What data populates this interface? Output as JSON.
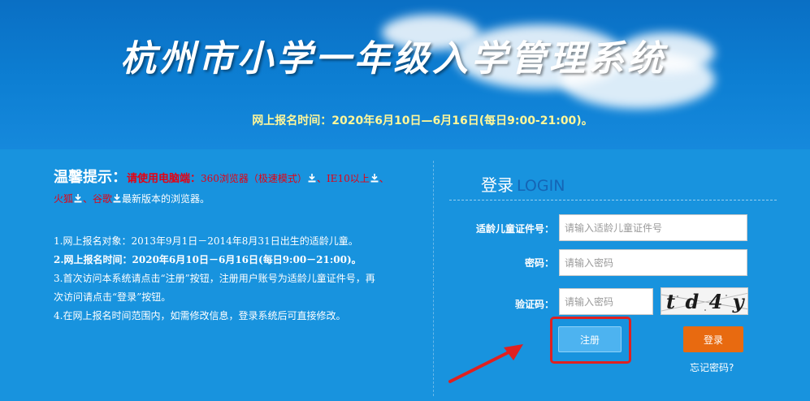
{
  "header": {
    "title": "杭州市小学一年级入学管理系统",
    "reg_time": "网上报名时间：2020年6月10日—6月16日(每日9:00-21:00)。"
  },
  "tips": {
    "heading": "温馨提示：",
    "red_text": "请使用电脑端：",
    "browser_360": "360浏览器（极速模式）",
    "browser_ie": "IE10以上",
    "browser_firefox": "火狐",
    "browser_chrome": "谷歌",
    "suffix": "最新版本的浏览器。",
    "item1": "1.网上报名对象：2013年9月1日－2014年8月31日出生的适龄儿童。",
    "item2": "2.网上报名时间：2020年6月10日－6月16日(每日9:00－21:00)。",
    "item3a": "3.首次访问本系统请点击“注册”按钮，注册用户账号为适龄儿童证件号，再",
    "item3b": "次访问请点击“登录”按钮。",
    "item4": "4.在网上报名时间范围内，如需修改信息，登录系统后可直接修改。",
    "sep1": "、",
    "sep2": "、",
    "sep3": "、",
    "download_icon": "download-icon"
  },
  "login": {
    "title_cn": "登录",
    "title_en": "LOGIN",
    "id_label": "适龄儿童证件号：",
    "id_placeholder": "请输入适龄儿童证件号",
    "pwd_label": "密码：",
    "pwd_placeholder": "请输入密码",
    "captcha_label": "验证码：",
    "captcha_placeholder": "请输入密码",
    "captcha_text": "t d 4 y",
    "register_label": "注册",
    "login_label": "登录",
    "forgot_label": "忘记密码?"
  },
  "colors": {
    "header_bg": "#0d7fd3",
    "main_bg": "#1893de",
    "warning_red": "#e60012",
    "login_orange": "#e86a10",
    "register_blue": "#4db3f0",
    "highlight_red": "#e02020"
  }
}
